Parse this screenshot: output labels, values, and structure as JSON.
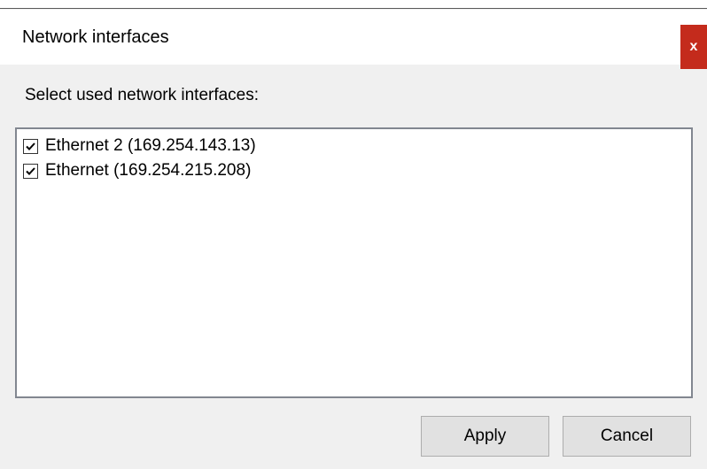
{
  "window": {
    "title": "Network interfaces",
    "close_label": "x"
  },
  "prompt": "Select used network interfaces:",
  "interfaces": [
    {
      "label": "Ethernet 2 (169.254.143.13)",
      "checked": true
    },
    {
      "label": "Ethernet (169.254.215.208)",
      "checked": true
    }
  ],
  "buttons": {
    "apply": "Apply",
    "cancel": "Cancel"
  },
  "colors": {
    "close_button": "#c42b1c",
    "dialog_background": "#f0f0f0"
  }
}
